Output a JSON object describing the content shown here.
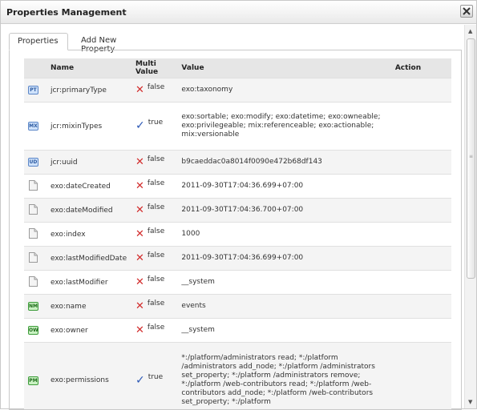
{
  "dialog": {
    "title": "Properties Management"
  },
  "tabs": [
    {
      "label": "Properties"
    },
    {
      "label": "Add New Property"
    }
  ],
  "table": {
    "headers": {
      "name": "Name",
      "multi": "Multi Value",
      "value": "Value",
      "action": "Action"
    },
    "rows": [
      {
        "icon": "PT",
        "icon_color": "blue",
        "name": "jcr:primaryType",
        "multi": false,
        "multi_text": "false",
        "value": "exo:taxonomy"
      },
      {
        "icon": "MX",
        "icon_color": "blue",
        "name": "jcr:mixinTypes",
        "multi": true,
        "multi_text": "true",
        "value": "exo:sortable; exo:modify; exo:datetime; exo:owneable; exo:privilegeable; mix:referenceable; exo:actionable; mix:versionable"
      },
      {
        "icon": "UD",
        "icon_color": "blue",
        "name": "jcr:uuid",
        "multi": false,
        "multi_text": "false",
        "value": "b9caeddac0a8014f0090e472b68df143"
      },
      {
        "icon": "doc",
        "icon_color": "gray",
        "name": "exo:dateCreated",
        "multi": false,
        "multi_text": "false",
        "value": "2011-09-30T17:04:36.699+07:00"
      },
      {
        "icon": "doc",
        "icon_color": "gray",
        "name": "exo:dateModified",
        "multi": false,
        "multi_text": "false",
        "value": "2011-09-30T17:04:36.700+07:00"
      },
      {
        "icon": "doc",
        "icon_color": "gray",
        "name": "exo:index",
        "multi": false,
        "multi_text": "false",
        "value": "1000"
      },
      {
        "icon": "doc",
        "icon_color": "gray",
        "name": "exo:lastModifiedDate",
        "multi": false,
        "multi_text": "false",
        "value": "2011-09-30T17:04:36.699+07:00"
      },
      {
        "icon": "doc",
        "icon_color": "gray",
        "name": "exo:lastModifier",
        "multi": false,
        "multi_text": "false",
        "value": "__system"
      },
      {
        "icon": "NM",
        "icon_color": "green",
        "name": "exo:name",
        "multi": false,
        "multi_text": "false",
        "value": "events"
      },
      {
        "icon": "OW",
        "icon_color": "green",
        "name": "exo:owner",
        "multi": false,
        "multi_text": "false",
        "value": "__system"
      },
      {
        "icon": "PM",
        "icon_color": "green",
        "name": "exo:permissions",
        "multi": true,
        "multi_text": "true",
        "value": "*:/platform/administrators read; *:/platform /administrators add_node; *:/platform /administrators set_property; *:/platform /administrators remove; *:/platform /web-contributors read; *:/platform /web-contributors add_node; *:/platform /web-contributors set_property; *:/platform"
      }
    ]
  }
}
